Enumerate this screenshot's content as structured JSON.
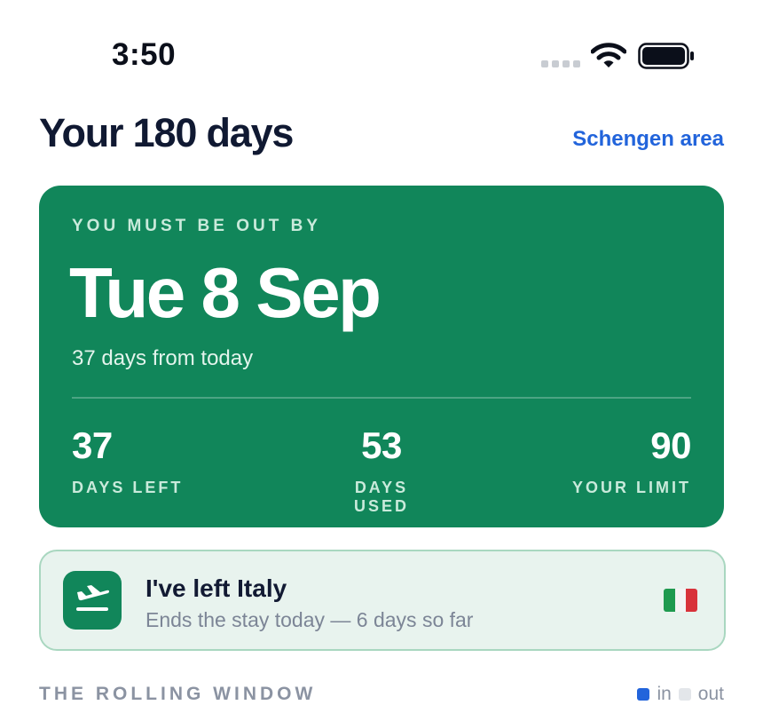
{
  "status_bar": {
    "time": "3:50"
  },
  "header": {
    "title": "Your 180 days",
    "region_link": "Schengen area"
  },
  "deadline_card": {
    "eyebrow": "YOU MUST BE OUT BY",
    "date": "Tue 8 Sep",
    "subtitle": "37 days from today",
    "stats": [
      {
        "value": "37",
        "label": "DAYS LEFT"
      },
      {
        "value": "53",
        "label": "DAYS USED"
      },
      {
        "value": "90",
        "label": "YOUR LIMIT"
      }
    ]
  },
  "trip_row": {
    "title": "I've left Italy",
    "subtitle": "Ends the stay today — 6 days so far",
    "flag": "italy-flag"
  },
  "rolling_window": {
    "title": "THE ROLLING WINDOW",
    "legend": [
      {
        "label": "in",
        "color": "#2264db"
      },
      {
        "label": "out",
        "color": "#e3e6ea"
      }
    ]
  },
  "colors": {
    "accent": "#2264db",
    "card_green": "#11865a",
    "trip_bg": "#e8f3ee"
  }
}
